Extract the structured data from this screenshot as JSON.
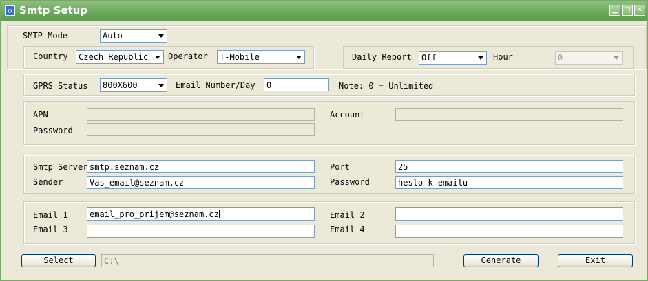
{
  "window": {
    "title": "Smtp Setup",
    "icon": "gear-icon"
  },
  "smtp": {
    "mode_label": "SMTP Mode",
    "mode_value": "Auto"
  },
  "region": {
    "country_label": "Country",
    "country_value": "Czech Republic",
    "operator_label": "Operator",
    "operator_value": "T-Mobile"
  },
  "report": {
    "daily_label": "Daily Report",
    "daily_value": "Off",
    "hour_label": "Hour",
    "hour_value": "0"
  },
  "gprs": {
    "status_label": "GPRS Status",
    "status_value": "800X600",
    "email_per_day_label": "Email Number/Day",
    "email_per_day_value": "0",
    "note": "Note: 0 = Unlimited"
  },
  "apn": {
    "apn_label": "APN",
    "apn_value": "",
    "account_label": "Account",
    "account_value": "",
    "password_label": "Password",
    "password_value": ""
  },
  "server": {
    "smtp_label": "Smtp Server",
    "smtp_value": "smtp.seznam.cz",
    "port_label": "Port",
    "port_value": "25",
    "sender_label": "Sender",
    "sender_value": "Vas_email@seznam.cz",
    "password_label": "Password",
    "password_value": "heslo k emailu"
  },
  "emails": {
    "email1_label": "Email 1",
    "email1_value": "email_pro_prijem@seznam.cz",
    "email2_label": "Email 2",
    "email2_value": "",
    "email3_label": "Email 3",
    "email3_value": "",
    "email4_label": "Email 4",
    "email4_value": ""
  },
  "footer": {
    "select_label": "Select",
    "path_value": "C:\\",
    "generate_label": "Generate",
    "exit_label": "Exit"
  }
}
